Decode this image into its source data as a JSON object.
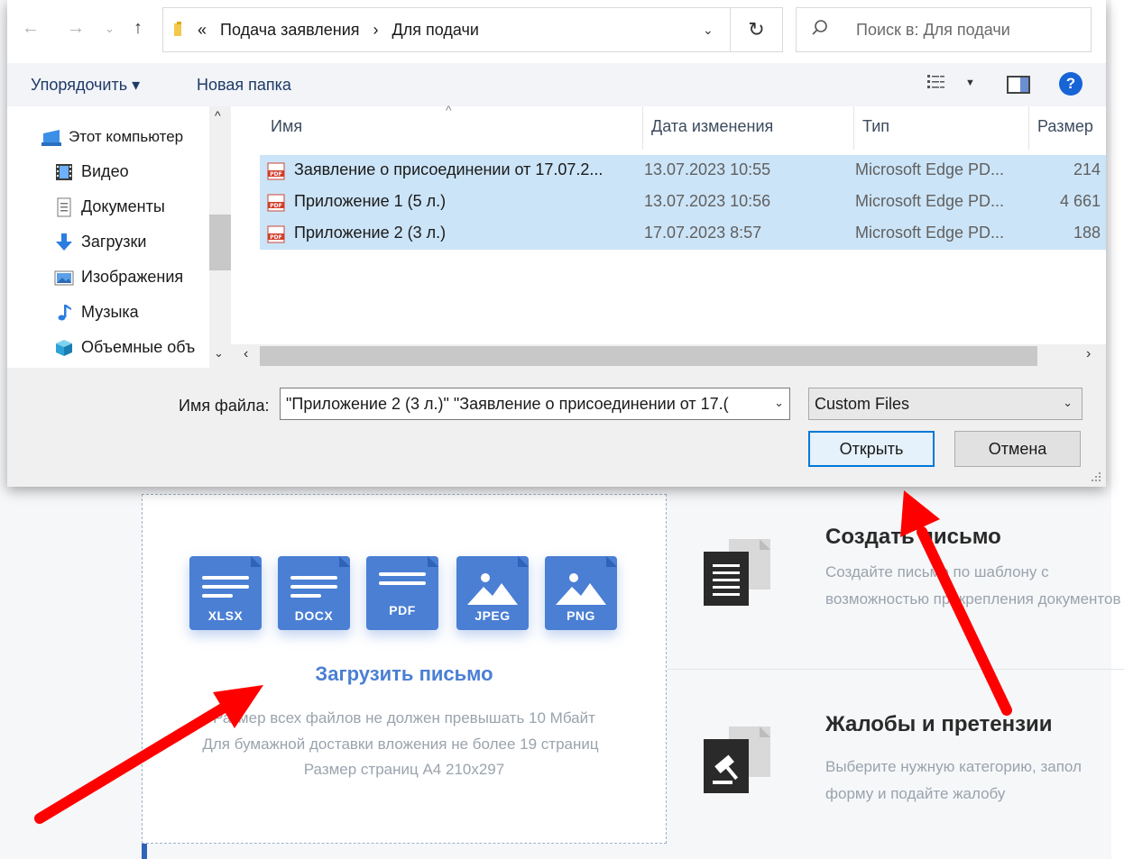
{
  "dialog": {
    "address": {
      "overflow": "«",
      "crumbs": [
        "Подача заявления",
        "›",
        "Для подачи"
      ]
    },
    "search_placeholder": "Поиск в: Для подачи",
    "toolbar": {
      "organize_label": "Упорядочить ▾",
      "new_folder_label": "Новая папка",
      "help_label": "?"
    },
    "nav_tree": [
      {
        "label": "Этот компьютер",
        "icon": "computer-icon"
      },
      {
        "label": "Видео",
        "icon": "video-icon"
      },
      {
        "label": "Документы",
        "icon": "documents-icon"
      },
      {
        "label": "Загрузки",
        "icon": "downloads-icon"
      },
      {
        "label": "Изображения",
        "icon": "pictures-icon"
      },
      {
        "label": "Музыка",
        "icon": "music-icon"
      },
      {
        "label": "Объемные объ",
        "icon": "3d-objects-icon"
      }
    ],
    "columns": {
      "name": "Имя",
      "modified": "Дата изменения",
      "type": "Тип",
      "size": "Размер"
    },
    "files": [
      {
        "name": "Заявление о присоединении от 17.07.2...",
        "modified": "13.07.2023 10:55",
        "type": "Microsoft Edge PD...",
        "size": "214"
      },
      {
        "name": "Приложение 1 (5 л.)",
        "modified": "13.07.2023 10:56",
        "type": "Microsoft Edge PD...",
        "size": "4 661"
      },
      {
        "name": "Приложение 2 (3 л.)",
        "modified": "17.07.2023 8:57",
        "type": "Microsoft Edge PD...",
        "size": "188"
      }
    ],
    "file_name_label": "Имя файла:",
    "file_name_value": "\"Приложение 2 (3 л.)\" \"Заявление о присоединении от 17.(",
    "file_type_value": "Custom Files",
    "open_label": "Открыть",
    "cancel_label": "Отмена"
  },
  "page": {
    "file_types": [
      "XLSX",
      "DOCX",
      "PDF",
      "JPEG",
      "PNG"
    ],
    "upload_title": "Загрузить письмо",
    "upload_hints": [
      "Размер всех файлов не должен превышать 10 Мбайт",
      "Для бумажной доставки вложения не более 19 страниц",
      "Размер страниц А4 210х297"
    ],
    "create_title": "Создать письмо",
    "create_desc": "Создайте письмо по шаблону с возможностью прикрепления документов",
    "complaints_title": "Жалобы и претензии",
    "complaints_desc": "Выберите нужную категорию, запол форму и подайте жалобу"
  },
  "colors": {
    "accent_blue": "#4a7fd4",
    "selection": "#cce4f7",
    "annotation_red": "#ff0000"
  }
}
